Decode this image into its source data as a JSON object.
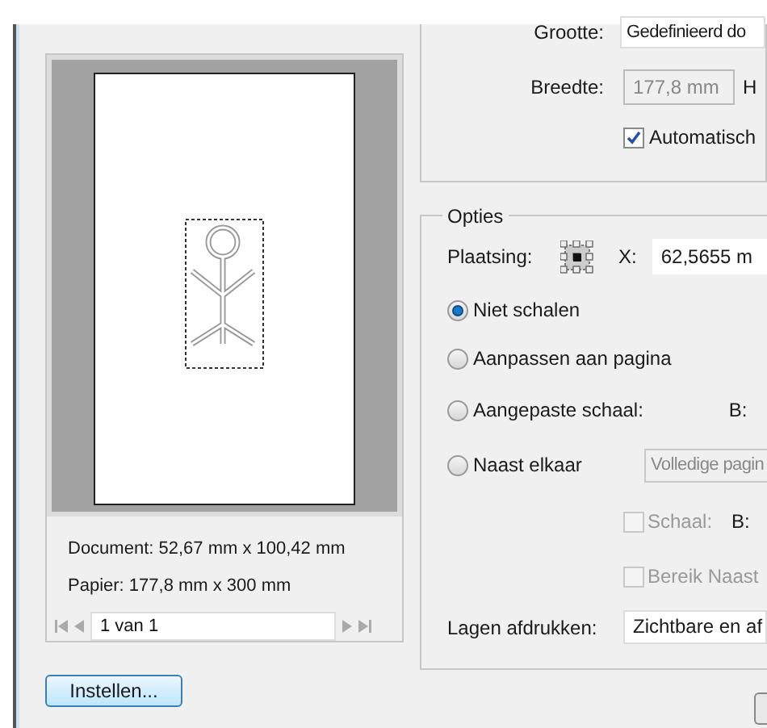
{
  "preview": {
    "document": "Document: 52,67 mm x 100,42 mm",
    "paper": "Papier: 177,8 mm x 300 mm",
    "page_field": "1 van 1"
  },
  "setup_button": "Instellen...",
  "size": {
    "size_label": "Grootte:",
    "size_value": "Gedefinieerd do",
    "width_label": "Breedte:",
    "width_value": "177,8 mm",
    "height_label": "H",
    "auto_label": "Automatisch",
    "auto_checked": true
  },
  "options": {
    "title": "Opties",
    "placement_label": "Plaatsing:",
    "x_label": "X:",
    "x_value": "62,5655 m",
    "scaling": [
      {
        "kind": "plain",
        "label": "Niet schalen",
        "selected": true
      },
      {
        "kind": "plain",
        "label": "Aanpassen aan pagina",
        "selected": false
      },
      {
        "kind": "suffix",
        "label": "Aangepaste schaal:",
        "selected": false,
        "suffix": "B:"
      },
      {
        "kind": "dropdown",
        "label": "Naast elkaar",
        "selected": false,
        "dropdown": "Volledige pagin"
      }
    ],
    "checks": [
      {
        "label": "Schaal:",
        "checked": false,
        "disabled": true,
        "suffix": "B:"
      },
      {
        "label": "Bereik Naast",
        "checked": false,
        "disabled": true
      }
    ],
    "layers_label": "Lagen afdrukken:",
    "layers_value": "Zichtbare en af"
  }
}
